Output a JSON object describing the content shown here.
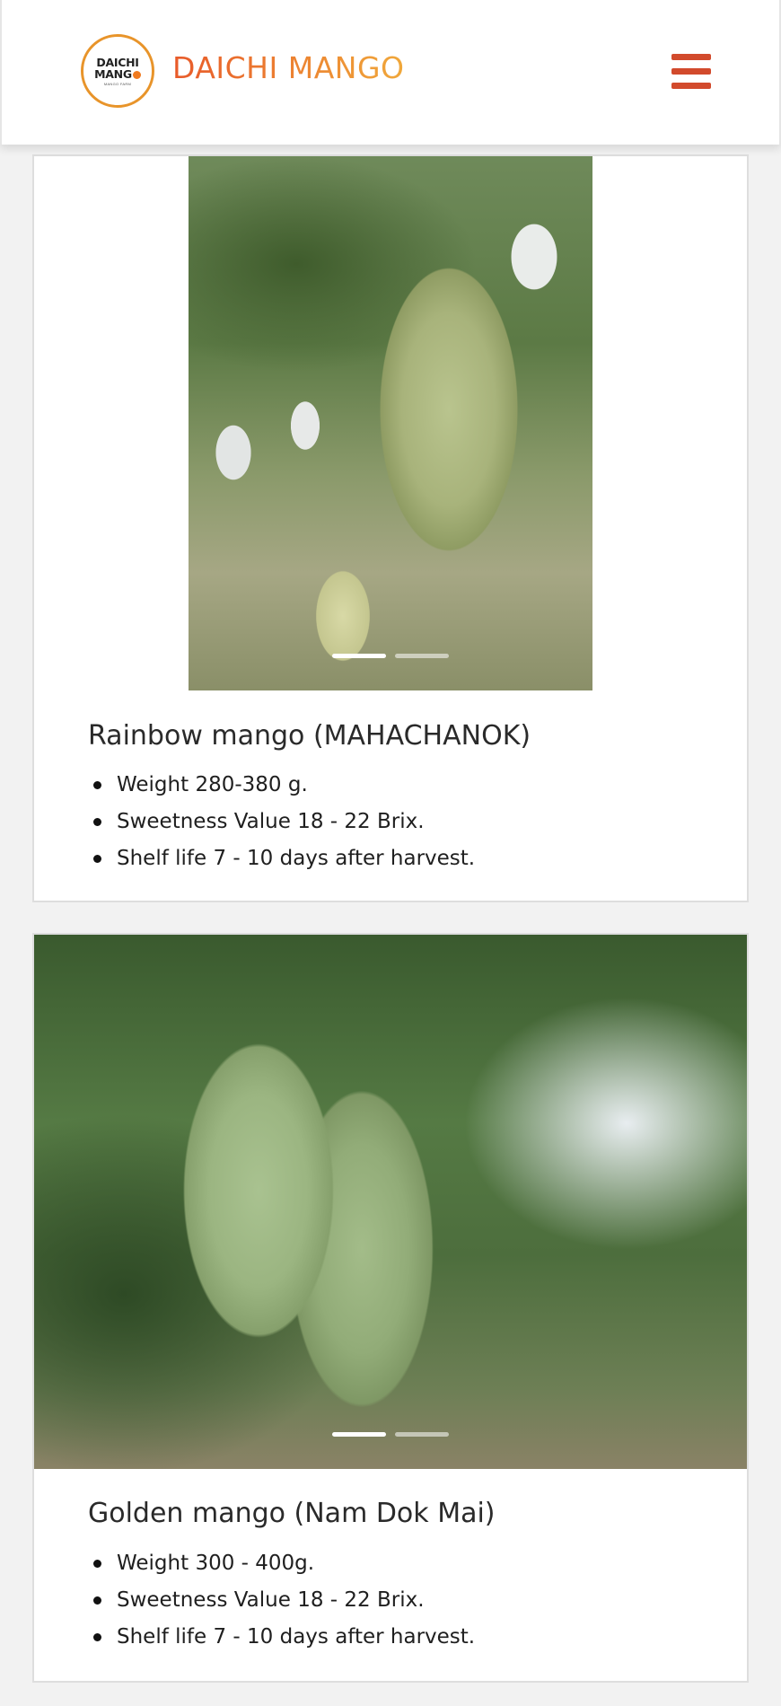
{
  "header": {
    "logo": {
      "line1": "DAICHI",
      "line2": "MANG",
      "tagline": "MANGO FARM"
    },
    "brand_name": "DAICHI MANGO",
    "menu_icon": "hamburger-menu-icon",
    "accent_color": "#d24a2c",
    "brand_gradient": [
      "#e85a2a",
      "#f0a83a"
    ]
  },
  "products": [
    {
      "title": "Rainbow mango (MAHACHANOK)",
      "specs": [
        "Weight 280-380 g.",
        "Sweetness Value 18 - 22 Brix.",
        "Shelf life 7 - 10 days after harvest."
      ],
      "carousel_active_index": 0,
      "carousel_count": 2
    },
    {
      "title": "Golden mango (Nam Dok Mai)",
      "specs": [
        "Weight 300 - 400g.",
        "Sweetness Value 18 - 22 Brix.",
        "Shelf life 7 - 10 days after harvest."
      ],
      "carousel_active_index": 0,
      "carousel_count": 2
    }
  ]
}
